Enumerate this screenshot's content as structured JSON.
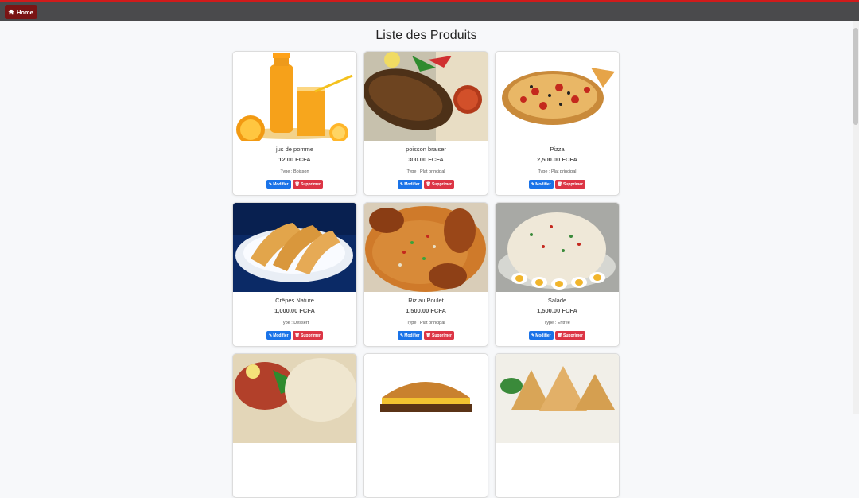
{
  "nav": {
    "home_label": "Home"
  },
  "page_title": "Liste des Produits",
  "type_prefix": "Type :",
  "buttons": {
    "edit": "Modifier",
    "delete": "Supprimer"
  },
  "colors": {
    "nav_bg": "#4a4a4c",
    "home_bg": "#7a1414",
    "edit": "#1a73e8",
    "delete": "#dc3545"
  },
  "products": [
    {
      "name": "jus de pomme",
      "price": "12.00 FCFA",
      "type": "Type : Boisson",
      "image": "juice-image"
    },
    {
      "name": "poisson braiser",
      "price": "300.00 FCFA",
      "type": "Type : Plat principal",
      "image": "grilled-fish-image"
    },
    {
      "name": "Pizza",
      "price": "2,500.00 FCFA",
      "type": "Type : Plat principal",
      "image": "pizza-image"
    },
    {
      "name": "Crêpes Nature",
      "price": "1,000.00 FCFA",
      "type": "Type : Dessert",
      "image": "crepes-image"
    },
    {
      "name": "Riz au Poulet",
      "price": "1,500.00 FCFA",
      "type": "Type : Plat principal",
      "image": "rice-chicken-image"
    },
    {
      "name": "Salade",
      "price": "1,500.00 FCFA",
      "type": "Type : Entrée",
      "image": "salad-image"
    },
    {
      "image": "fish-rice-image"
    },
    {
      "image": "burger-image"
    },
    {
      "image": "samosa-image"
    }
  ]
}
